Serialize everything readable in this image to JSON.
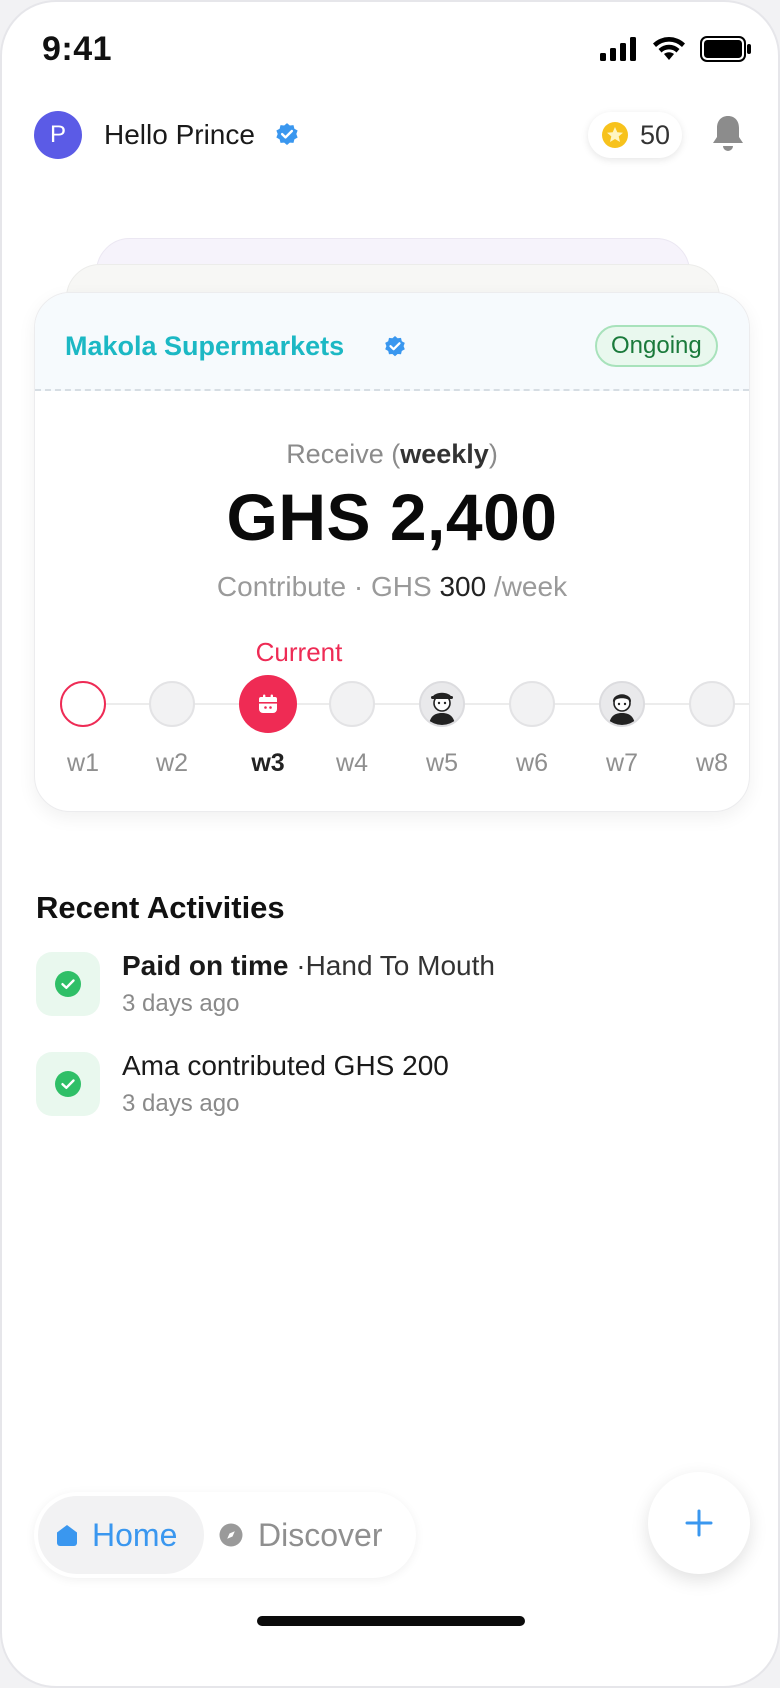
{
  "status_bar": {
    "time": "9:41"
  },
  "header": {
    "avatar_initial": "P",
    "greeting": "Hello Prince",
    "points": "50"
  },
  "group_card": {
    "name": "Makola Supermarkets",
    "status": "Ongoing",
    "receive_prefix": "Receive (",
    "receive_period": "weekly",
    "receive_suffix": ")",
    "receive_amount": "GHS 2,400",
    "contribute_prefix": "Contribute · GHS ",
    "contribute_amount": "300",
    "contribute_suffix": " /week",
    "current_label": "Current",
    "weeks": [
      {
        "label": "w1",
        "state": "past"
      },
      {
        "label": "w2",
        "state": "upcoming"
      },
      {
        "label": "w3",
        "state": "current"
      },
      {
        "label": "w4",
        "state": "upcoming"
      },
      {
        "label": "w5",
        "state": "member"
      },
      {
        "label": "w6",
        "state": "upcoming"
      },
      {
        "label": "w7",
        "state": "member"
      },
      {
        "label": "w8",
        "state": "upcoming"
      }
    ]
  },
  "activities": {
    "title": "Recent Activities",
    "items": [
      {
        "bold": "Paid on time",
        "rest": " ·Hand To Mouth",
        "time": "3 days ago"
      },
      {
        "bold": "",
        "rest": "Ama contributed GHS 200",
        "time": "3 days ago"
      }
    ]
  },
  "bottom_nav": {
    "home_label": "Home",
    "discover_label": "Discover"
  },
  "colors": {
    "accent_blue": "#3a97ef",
    "brand_teal": "#1cb8c4",
    "current_red": "#ef2b54",
    "success_green": "#2fbf67"
  }
}
